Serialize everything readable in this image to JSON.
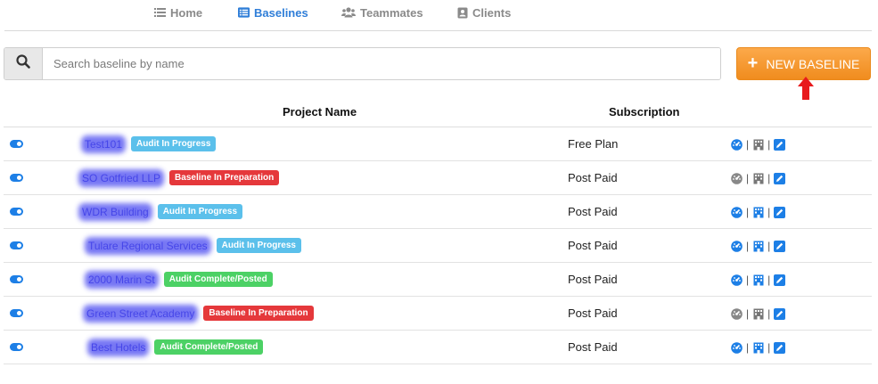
{
  "nav": {
    "tabs": [
      {
        "label": "Home",
        "icon": "list-icon"
      },
      {
        "label": "Baselines",
        "icon": "list-alt-icon",
        "active": true
      },
      {
        "label": "Teammates",
        "icon": "users-icon"
      },
      {
        "label": "Clients",
        "icon": "contact-card-icon"
      }
    ]
  },
  "search": {
    "placeholder": "Search baseline by name",
    "value": ""
  },
  "new_button": {
    "label": "NEW BASELINE"
  },
  "table": {
    "headers": {
      "project": "Project Name",
      "subscription": "Subscription"
    },
    "rows": [
      {
        "name": "Test101",
        "status": "Audit In Progress",
        "subscription": "Free Plan"
      },
      {
        "name": "SO Gotfried LLP",
        "status": "Baseline In Preparation",
        "subscription": "Post Paid"
      },
      {
        "name": "WDR Building",
        "status": "Audit In Progress",
        "subscription": "Post Paid"
      },
      {
        "name": "Tulare Regional Services",
        "status": "Audit In Progress",
        "subscription": "Post Paid"
      },
      {
        "name": "2000 Marin St",
        "status": "Audit Complete/Posted",
        "subscription": "Post Paid"
      },
      {
        "name": "Green Street Academy",
        "status": "Baseline In Preparation",
        "subscription": "Post Paid"
      },
      {
        "name": "Best Hotels",
        "status": "Audit Complete/Posted",
        "subscription": "Post Paid"
      }
    ]
  },
  "colors": {
    "accent": "#2f7ed8",
    "toggle": "#1d7fe6",
    "badge_in_progress": "#5bc0eb",
    "badge_preparation": "#e5383b",
    "badge_complete": "#4cd165",
    "button_orange": "#f7931e",
    "arrow_red": "#e8191c"
  }
}
